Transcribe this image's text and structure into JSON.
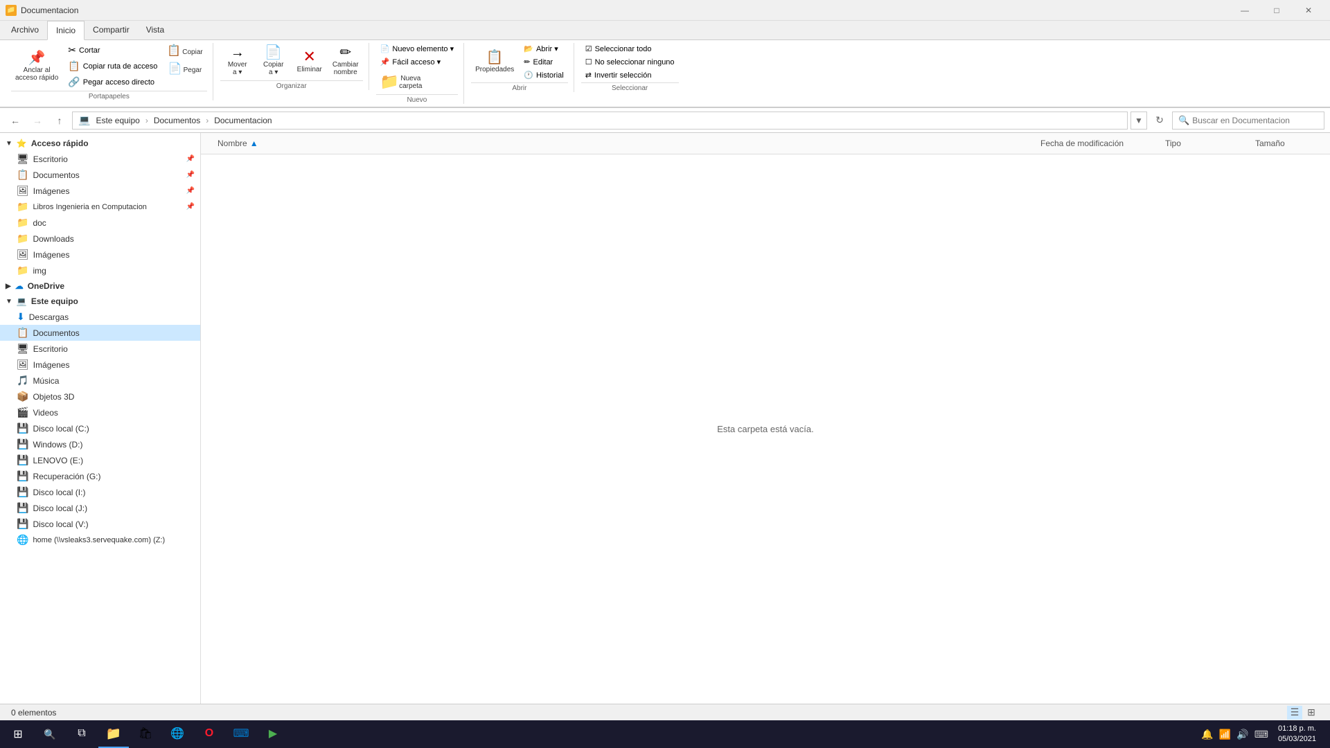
{
  "titleBar": {
    "title": "Documentacion",
    "icon": "📁",
    "minimizeLabel": "—",
    "maximizeLabel": "□",
    "closeLabel": "✕"
  },
  "ribbon": {
    "tabs": [
      "Archivo",
      "Inicio",
      "Compartir",
      "Vista"
    ],
    "activeTab": "Inicio",
    "groups": {
      "portapapeles": {
        "label": "Portapapeles",
        "buttons": [
          {
            "icon": "📌",
            "label": "Anclar al\nacceso rápido"
          },
          {
            "icon": "📋",
            "label": "Copiar"
          },
          {
            "icon": "📄",
            "label": "Pegar"
          }
        ],
        "smallButtons": [
          {
            "icon": "✂",
            "label": "Cortar"
          },
          {
            "icon": "📋",
            "label": "Copiar ruta de acceso"
          },
          {
            "icon": "🔗",
            "label": "Pegar acceso directo"
          }
        ]
      },
      "organizar": {
        "label": "Organizar",
        "buttons": [
          {
            "icon": "→",
            "label": "Mover\na ▾"
          },
          {
            "icon": "📄",
            "label": "Copiar\na ▾"
          },
          {
            "icon": "✕",
            "label": "Eliminar"
          },
          {
            "icon": "✏",
            "label": "Cambiar\nnombre"
          }
        ]
      },
      "nuevo": {
        "label": "Nuevo",
        "buttons": [
          {
            "icon": "📁",
            "label": "Nueva\ncarpeta"
          }
        ],
        "dropdown": "Nuevo elemento ▾",
        "dropdown2": "Fácil acceso ▾"
      },
      "abrir": {
        "label": "Abrir",
        "buttons": [
          {
            "icon": "👁",
            "label": "Propiedades"
          },
          {
            "icon": "📂",
            "label": "Abrir ▾"
          },
          {
            "icon": "✏",
            "label": "Editar"
          },
          {
            "icon": "🕐",
            "label": "Historial"
          }
        ]
      },
      "seleccionar": {
        "label": "Seleccionar",
        "buttons": [
          {
            "icon": "☑",
            "label": "Seleccionar todo"
          },
          {
            "icon": "☐",
            "label": "No seleccionar ninguno"
          },
          {
            "icon": "⇄",
            "label": "Invertir selección"
          }
        ]
      }
    }
  },
  "addressBar": {
    "backDisabled": false,
    "forwardDisabled": true,
    "upDisabled": false,
    "path": [
      "Este equipo",
      "Documentos",
      "Documentacion"
    ],
    "searchPlaceholder": "Buscar en Documentacion"
  },
  "sidebar": {
    "sections": [
      {
        "id": "acceso-rapido",
        "icon": "⭐",
        "label": "Acceso rápido",
        "expanded": true,
        "items": [
          {
            "id": "escritorio-pinned",
            "icon": "🖥",
            "label": "Escritorio",
            "pinned": true
          },
          {
            "id": "documentos-pinned",
            "icon": "📋",
            "label": "Documentos",
            "pinned": true
          },
          {
            "id": "imagenes-pinned",
            "icon": "🖼",
            "label": "Imágenes",
            "pinned": true
          },
          {
            "id": "libros-ingenieria",
            "icon": "📁",
            "label": "Libros Ingenieria en Computacion",
            "pinned": true
          },
          {
            "id": "doc",
            "icon": "📁",
            "label": "doc",
            "pinned": false
          },
          {
            "id": "downloads",
            "icon": "📁",
            "label": "Downloads",
            "pinned": false
          },
          {
            "id": "imagenes2",
            "icon": "🖼",
            "label": "Imágenes",
            "pinned": false
          },
          {
            "id": "img",
            "icon": "📁",
            "label": "img",
            "pinned": false
          }
        ]
      },
      {
        "id": "onedrive",
        "icon": "☁",
        "label": "OneDrive",
        "expanded": false,
        "items": []
      },
      {
        "id": "este-equipo",
        "icon": "💻",
        "label": "Este equipo",
        "expanded": true,
        "items": [
          {
            "id": "descargas",
            "icon": "⬇",
            "label": "Descargas",
            "active": false
          },
          {
            "id": "documentos-eq",
            "icon": "📋",
            "label": "Documentos",
            "active": true
          },
          {
            "id": "escritorio-eq",
            "icon": "🖥",
            "label": "Escritorio",
            "active": false
          },
          {
            "id": "imagenes-eq",
            "icon": "🖼",
            "label": "Imágenes",
            "active": false
          },
          {
            "id": "musica",
            "icon": "🎵",
            "label": "Música",
            "active": false
          },
          {
            "id": "objetos3d",
            "icon": "📦",
            "label": "Objetos 3D",
            "active": false
          },
          {
            "id": "videos",
            "icon": "🎬",
            "label": "Videos",
            "active": false
          },
          {
            "id": "disco-c",
            "icon": "💾",
            "label": "Disco local (C:)",
            "active": false
          },
          {
            "id": "windows-d",
            "icon": "💾",
            "label": "Windows (D:)",
            "active": false
          },
          {
            "id": "lenovo-e",
            "icon": "💾",
            "label": "LENOVO (E:)",
            "active": false
          },
          {
            "id": "recuperacion-g",
            "icon": "💾",
            "label": "Recuperación (G:)",
            "active": false
          },
          {
            "id": "disco-i",
            "icon": "💾",
            "label": "Disco local (I:)",
            "active": false
          },
          {
            "id": "disco-j",
            "icon": "💾",
            "label": "Disco local (J:)",
            "active": false
          },
          {
            "id": "disco-v",
            "icon": "💾",
            "label": "Disco local (V:)",
            "active": false
          },
          {
            "id": "home-z",
            "icon": "🌐",
            "label": "home (\\\\vsleaks3.servequake.com) (Z:)",
            "active": false
          }
        ]
      }
    ]
  },
  "content": {
    "columns": [
      {
        "id": "nombre",
        "label": "Nombre",
        "sortIndicator": "▲"
      },
      {
        "id": "fecha",
        "label": "Fecha de modificación"
      },
      {
        "id": "tipo",
        "label": "Tipo"
      },
      {
        "id": "tamano",
        "label": "Tamaño"
      }
    ],
    "emptyMessage": "Esta carpeta está vacía."
  },
  "statusBar": {
    "itemCount": "0 elementos"
  },
  "taskbar": {
    "items": [
      {
        "id": "start",
        "icon": "⊞",
        "label": "Inicio"
      },
      {
        "id": "search",
        "icon": "🔍",
        "label": "Buscar"
      },
      {
        "id": "task-view",
        "icon": "⧉",
        "label": "Vista de tareas"
      },
      {
        "id": "file-explorer",
        "icon": "📁",
        "label": "Explorador de archivos",
        "active": true
      },
      {
        "id": "store",
        "icon": "🛍",
        "label": "Microsoft Store"
      },
      {
        "id": "edge",
        "icon": "🌐",
        "label": "Microsoft Edge"
      },
      {
        "id": "opera",
        "icon": "O",
        "label": "Opera"
      },
      {
        "id": "vscode",
        "icon": "⌨",
        "label": "Visual Studio Code"
      },
      {
        "id": "app6",
        "icon": "▶",
        "label": "App6"
      }
    ],
    "tray": {
      "icons": [
        "🔔",
        "📶",
        "🔊",
        "⌨"
      ],
      "time": "01:18 p. m.",
      "date": "05/03/2021"
    }
  }
}
